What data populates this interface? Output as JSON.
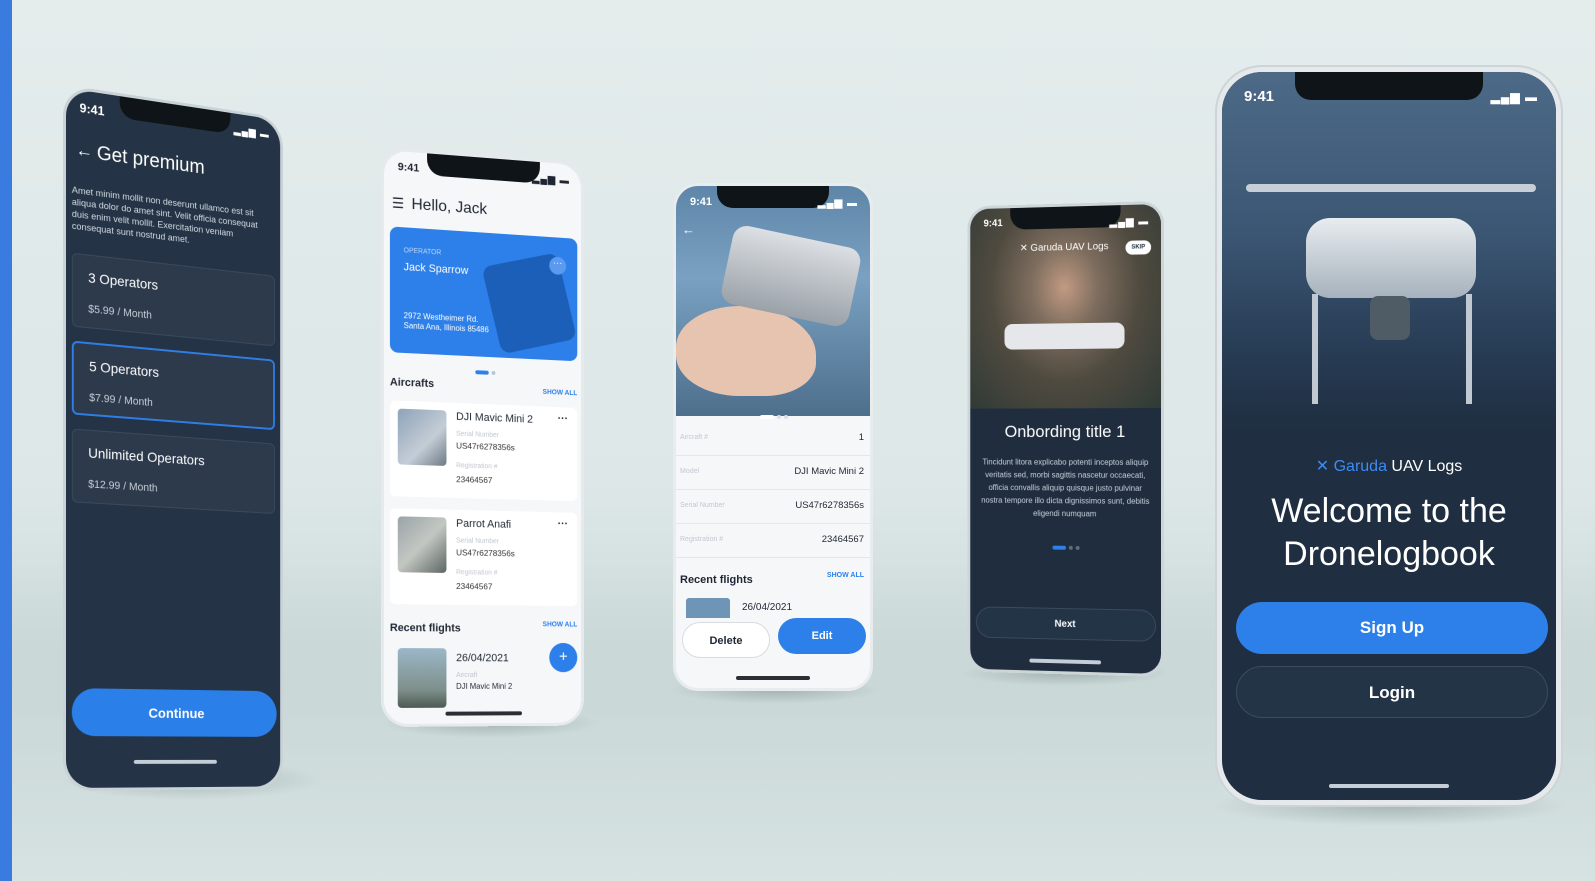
{
  "status_time": "9:41",
  "premium": {
    "title": "Get premium",
    "description": "Amet minim mollit non deserunt ullamco est sit aliqua dolor do amet sint. Velit officia consequat duis enim velit mollit. Exercitation veniam consequat sunt nostrud amet.",
    "plans": [
      {
        "name": "3 Operators",
        "price": "$5.99 / Month"
      },
      {
        "name": "5 Operators",
        "price": "$7.99 / Month"
      },
      {
        "name": "Unlimited Operators",
        "price": "$12.99 / Month"
      }
    ],
    "continue_label": "Continue"
  },
  "home": {
    "greeting": "Hello, Jack",
    "operator_label": "OPERATOR",
    "operator_name": "Jack Sparrow",
    "address": "2972 Westheimer Rd. Santa Ana, Illinois 85486",
    "aircrafts_title": "Aircrafts",
    "show_all": "SHOW ALL",
    "aircrafts": [
      {
        "name": "DJI Mavic Mini 2",
        "serial_label": "Serial Number",
        "serial": "US47r6278356s",
        "reg_label": "Registration #",
        "reg": "23464567"
      },
      {
        "name": "Parrot Anafi",
        "serial_label": "Serial Number",
        "serial": "US47r6278356s",
        "reg_label": "Registration #",
        "reg": "23464567"
      }
    ],
    "recent_title": "Recent flights",
    "flight": {
      "date": "26/04/2021",
      "aircraft_label": "Aircraft",
      "aircraft": "DJI Mavic Mini 2"
    },
    "fab": "+"
  },
  "detail": {
    "rows": [
      {
        "k": "Aircraft #",
        "v": "1"
      },
      {
        "k": "Model",
        "v": "DJI Mavic Mini 2"
      },
      {
        "k": "Serial Number",
        "v": "US47r6278356s"
      },
      {
        "k": "Registration #",
        "v": "23464567"
      }
    ],
    "recent_title": "Recent flights",
    "show_all": "SHOW ALL",
    "flight_date": "26/04/2021",
    "delete_label": "Delete",
    "edit_label": "Edit"
  },
  "onboarding": {
    "brand": "Garuda UAV Logs",
    "skip": "SKIP",
    "title": "Onbording title 1",
    "body": "Tincidunt litora explicabo potenti inceptos aliquip veritatis sed, morbi sagittis nascetur occaecati, officia convallis aliquip quisque justo pulvinar nostra tempore illo dicta dignissimos sunt, debitis eligendi numquam",
    "next_label": "Next"
  },
  "welcome": {
    "brand_accent": "Garuda",
    "brand_rest": " UAV Logs",
    "headline": "Welcome to the Dronelogbook",
    "signup_label": "Sign Up",
    "login_label": "Login"
  },
  "colors": {
    "accent": "#2d80ea",
    "dark_bg": "#243345",
    "edge_strip": "#3a7be0"
  }
}
